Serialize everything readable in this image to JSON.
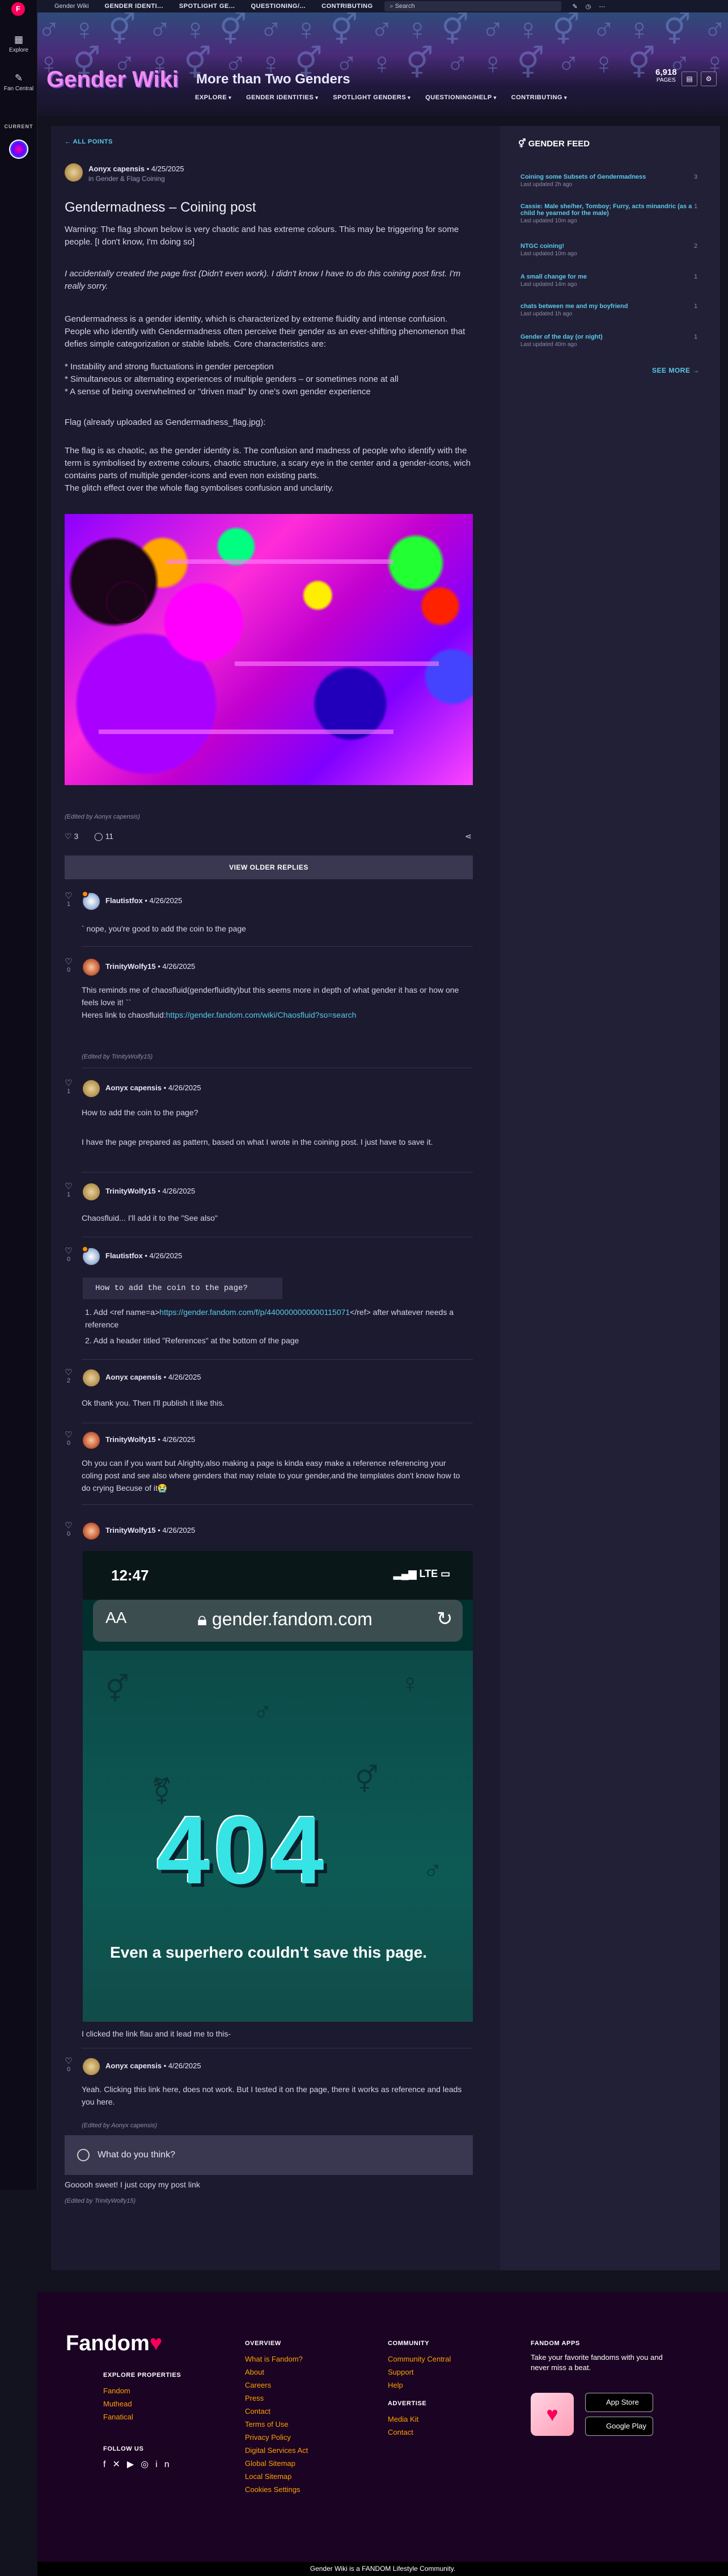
{
  "colors": {
    "accent": "#59c9e9",
    "fandom_red": "#fa005a",
    "footer_link": "#fca100",
    "wordmark": "#f18cf2"
  },
  "rail": {
    "logo": "F",
    "explore": "Explore",
    "fan_central": "Fan Central",
    "current": "CURRENT"
  },
  "topbar": {
    "wiki_name": "Gender Wiki",
    "nav": [
      "GENDER IDENTI...",
      "SPOTLIGHT GE...",
      "QUESTIONING/...",
      "CONTRIBUTING"
    ],
    "search_placeholder": "Search"
  },
  "banner": {
    "wordmark": "Gender Wiki",
    "tagline": "More than Two Genders",
    "pages_count": "6,918",
    "pages_label": "PAGES",
    "nav": [
      "EXPLORE",
      "GENDER IDENTITIES",
      "SPOTLIGHT GENDERS",
      "QUESTIONING/HELP",
      "CONTRIBUTING"
    ]
  },
  "post": {
    "back_link": "ALL POINTS",
    "author": "Aonyx capensis",
    "date": "4/25/2025",
    "category": "in Gender & Flag Coining",
    "title": "Gendermadness – Coining post",
    "p1": "Warning: The flag shown below is very chaotic and has extreme colours. This may be triggering for some people. [I don't know. (Didn't even work)  I didn't know I have to do this coining post first. I'm really sorry.",
    "p1a": "Warning: The flag shown below is very chaotic and has extreme colours. This may be triggering for some people. [I don't know, I'm doing so]",
    "p2": "I accidentally created the page first (Didn't even work).  I didn't know I have to do this coining post first. I'm really sorry.",
    "p3": "Gendermadness is a gender identity, which is characterized by extreme fluidity and intense confusion. People who identify with Gendermadness often perceive their gender as an ever-shifting phenomenon that defies simple categorization or stable labels. Core characteristics are:",
    "b1": "* Instability and strong fluctuations in gender perception",
    "b2": "* Simultaneous or alternating experiences of multiple genders – or sometimes none at all",
    "b3": "* A sense of being overwhelmed or \"driven mad\" by one's own gender experience",
    "p4": "Flag (already uploaded as Gendermadness_flag.jpg):",
    "p5": "The flag is as chaotic, as the gender identity is. The confusion and madness of people who identify with the term is symbolised by extreme colours, chaotic structure, a scary eye in the center and a gender-icons, wich contains parts of multiple gender-icons and even non existing parts.",
    "p6": "The glitch effect over the whole flag symbolises confusion and unclarity.",
    "edited": "(Edited by Aonyx capensis)",
    "likes": "3",
    "replies": "11",
    "older_replies_button": "VIEW OLDER REPLIES"
  },
  "replies": [
    {
      "author": "Flautistfox",
      "date": "4/26/2025",
      "likes": "1",
      "text": "` nope, you're good to add the coin to the page"
    },
    {
      "author": "TrinityWolfy15",
      "date": "4/26/2025",
      "likes": "0",
      "text": "This reminds me of chaosfluid(genderfluidity)but this seems more in depth of what gender it has or how one feels love it! ``",
      "text2": "Heres link to chaosfluid:",
      "link": "https://gender.fandom.com/wiki/Chaosfluid?so=search",
      "edited": "(Edited by TrinityWolfy15)"
    },
    {
      "author": "Aonyx capensis",
      "date": "4/26/2025",
      "likes": "1",
      "text": "How to add the coin to the page?",
      "text2": "I have the page prepared as pattern, based on what I wrote in the coining post. I just have to save it."
    },
    {
      "author": "TrinityWolfy15",
      "date": "4/26/2025",
      "likes": "1",
      "text": "Chaosfluid... I'll add it to the \"See also\""
    },
    {
      "author": "Flautistfox",
      "date": "4/26/2025",
      "likes": "0",
      "code": "How to add the coin to the page?",
      "li1a": "Add <ref name=a>",
      "li1link": "https://gender.fandom.com/f/p/4400000000000115071",
      "li1b": "</ref> after whatever needs a reference",
      "li2": "Add a header titled \"References\" at the bottom of the page"
    },
    {
      "author": "Aonyx capensis",
      "date": "4/26/2025",
      "likes": "2",
      "text": "Ok thank you. Then I'll publish it like this."
    },
    {
      "author": "TrinityWolfy15",
      "date": "4/26/2025",
      "likes": "0",
      "text": "Oh you can if you want but Alrighty,also making a page is kinda easy make a reference referencing your coling post and see also where genders that may relate to your gender,and the templates don't know how to do crying Becuse of it😭"
    },
    {
      "author": "TrinityWolfy15",
      "date": "4/26/2025",
      "likes": "0",
      "text": "I clicked the link flau and it lead me to this-"
    },
    {
      "author": "Aonyx capensis",
      "date": "4/26/2025",
      "likes": "0",
      "text": "Yeah. Clicking this link here, does not work. But I tested it on the page, there it works as reference and leads you here.",
      "edited": "(Edited by Aonyx capensis)"
    }
  ],
  "screenshot": {
    "time": "12:47",
    "network": "LTE",
    "aa": "AA",
    "url": "gender.fandom.com",
    "code": "404",
    "message": "Even a superhero couldn't save this page."
  },
  "comment_box": {
    "placeholder": "What do you think?"
  },
  "last_reply": {
    "text": "Gooooh sweet! I just copy my post link",
    "edited": "(Edited by TrinityWolfy15)"
  },
  "feed": {
    "title": "GENDER FEED",
    "items": [
      {
        "title": "Coining some Subsets of Gendermadness",
        "sub": "Last updated 2h ago",
        "count": "3"
      },
      {
        "title": "Cassie: Male she/her, Tomboy; Furry, acts minandric (as a child he yearned for the male)",
        "sub": "Last updated 10m ago",
        "count": "1"
      },
      {
        "title": "NTGC coining!",
        "sub": "Last updated 10m ago",
        "count": "2"
      },
      {
        "title": "A small change for me",
        "sub": "Last updated 14m ago",
        "count": "1"
      },
      {
        "title": "chats between me and my boyfriend",
        "sub": "Last updated 1h ago",
        "count": "1"
      },
      {
        "title": "Gender of the day (or night)",
        "sub": "Last updated 40m ago",
        "count": "1"
      }
    ],
    "see_more": "SEE MORE"
  },
  "footer": {
    "logo": "Fandom",
    "explore_title": "EXPLORE PROPERTIES",
    "explore": [
      "Fandom",
      "Muthead",
      "Fanatical"
    ],
    "follow_title": "FOLLOW US",
    "overview_title": "OVERVIEW",
    "overview": [
      "What is Fandom?",
      "About",
      "Careers",
      "Press",
      "Contact",
      "Terms of Use",
      "Privacy Policy",
      "Digital Services Act",
      "Global Sitemap",
      "Local Sitemap",
      "Cookies Settings"
    ],
    "community_title": "COMMUNITY",
    "community": [
      "Community Central",
      "Support",
      "Help"
    ],
    "advertise_title": "ADVERTISE",
    "advertise": [
      "Media Kit",
      "Contact"
    ],
    "apps_title": "FANDOM APPS",
    "apps_text": "Take your favorite fandoms with you and never miss a beat.",
    "app_store": "App Store",
    "google_play": "Google Play",
    "bottom": "Gender Wiki is a FANDOM Lifestyle Community."
  }
}
